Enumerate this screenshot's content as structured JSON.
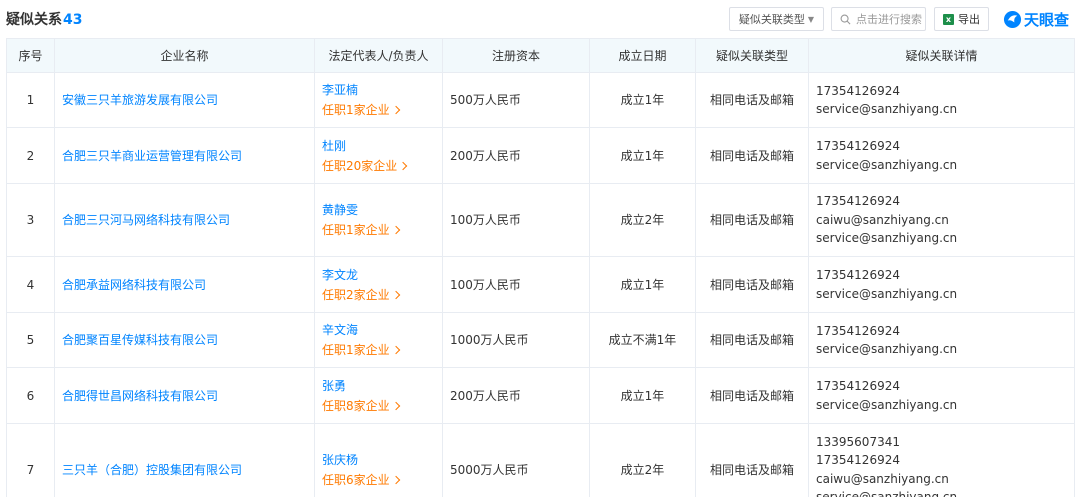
{
  "header": {
    "title": "疑似关系",
    "count": "43",
    "type_filter_label": "疑似关联类型",
    "search_placeholder": "点击进行搜索",
    "export_label": "导出",
    "logo_text": "天眼查"
  },
  "table": {
    "columns": [
      "序号",
      "企业名称",
      "法定代表人/负责人",
      "注册资本",
      "成立日期",
      "疑似关联类型",
      "疑似关联详情"
    ],
    "rows": [
      {
        "index": "1",
        "company": "安徽三只羊旅游发展有限公司",
        "person": "李亚楠",
        "tenure": "任职1家企业",
        "capital": "500万人民币",
        "founded": "成立1年",
        "relation": "相同电话及邮箱",
        "details": [
          "17354126924",
          "service@sanzhiyang.cn"
        ]
      },
      {
        "index": "2",
        "company": "合肥三只羊商业运营管理有限公司",
        "person": "杜刚",
        "tenure": "任职20家企业",
        "capital": "200万人民币",
        "founded": "成立1年",
        "relation": "相同电话及邮箱",
        "details": [
          "17354126924",
          "service@sanzhiyang.cn"
        ]
      },
      {
        "index": "3",
        "company": "合肥三只河马网络科技有限公司",
        "person": "黄静雯",
        "tenure": "任职1家企业",
        "capital": "100万人民币",
        "founded": "成立2年",
        "relation": "相同电话及邮箱",
        "details": [
          "17354126924",
          "caiwu@sanzhiyang.cn",
          "service@sanzhiyang.cn"
        ]
      },
      {
        "index": "4",
        "company": "合肥承益网络科技有限公司",
        "person": "李文龙",
        "tenure": "任职2家企业",
        "capital": "100万人民币",
        "founded": "成立1年",
        "relation": "相同电话及邮箱",
        "details": [
          "17354126924",
          "service@sanzhiyang.cn"
        ]
      },
      {
        "index": "5",
        "company": "合肥聚百星传媒科技有限公司",
        "person": "辛文海",
        "tenure": "任职1家企业",
        "capital": "1000万人民币",
        "founded": "成立不满1年",
        "relation": "相同电话及邮箱",
        "details": [
          "17354126924",
          "service@sanzhiyang.cn"
        ]
      },
      {
        "index": "6",
        "company": "合肥得世昌网络科技有限公司",
        "person": "张勇",
        "tenure": "任职8家企业",
        "capital": "200万人民币",
        "founded": "成立1年",
        "relation": "相同电话及邮箱",
        "details": [
          "17354126924",
          "service@sanzhiyang.cn"
        ]
      },
      {
        "index": "7",
        "company": "三只羊（合肥）控股集团有限公司",
        "person": "张庆杨",
        "tenure": "任职6家企业",
        "capital": "5000万人民币",
        "founded": "成立2年",
        "relation": "相同电话及邮箱",
        "details": [
          "13395607341",
          "17354126924",
          "caiwu@sanzhiyang.cn",
          "service@sanzhiyang.cn"
        ]
      }
    ]
  },
  "colors": {
    "accent": "#0084ff",
    "tenure": "#ff7a00",
    "header_bg": "#f2f9fc",
    "border": "#e8ecf2"
  }
}
